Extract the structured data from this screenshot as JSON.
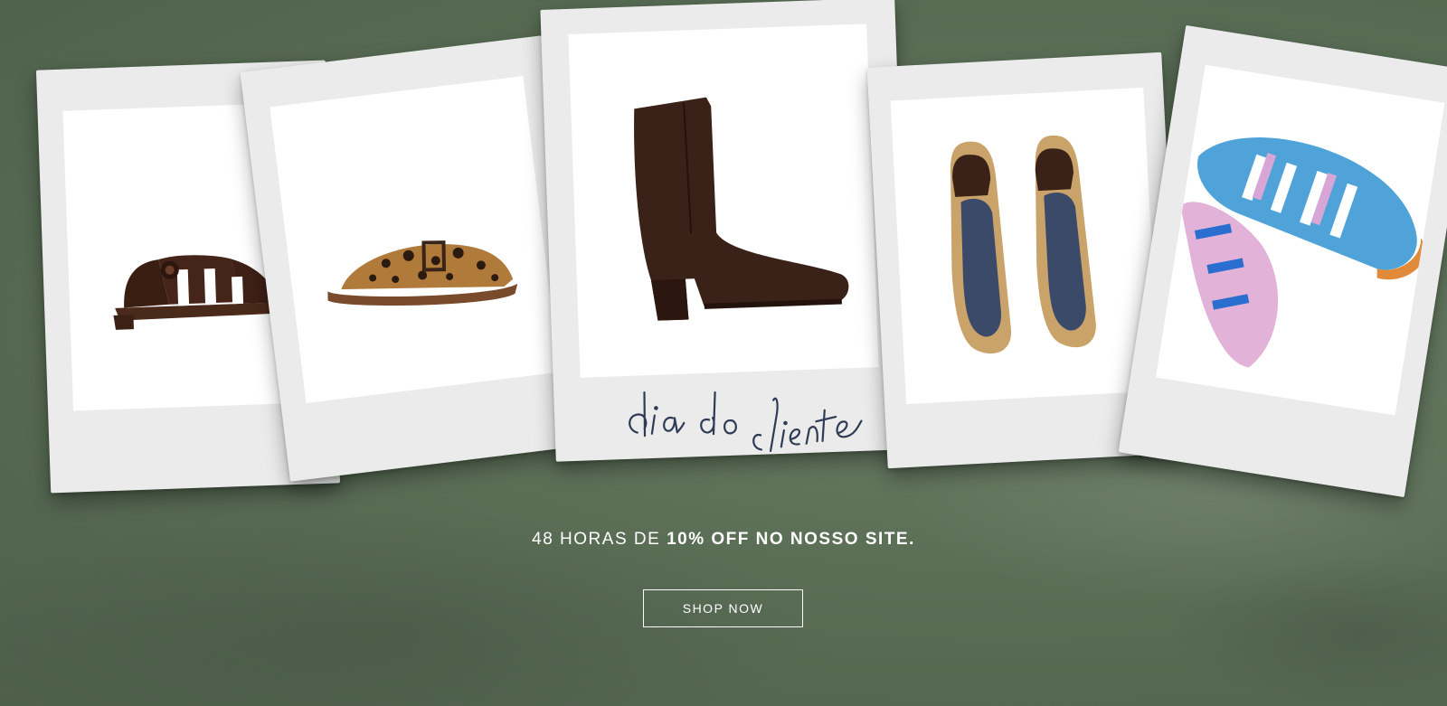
{
  "banner": {
    "script_title": "dia do cliente",
    "promo_prefix": "48 HORAS DE ",
    "promo_highlight": "10% OFF NO NOSSO SITE.",
    "cta_label": "SHOP NOW"
  },
  "products": [
    {
      "name": "dark-brown-fisherman-sandal-photo"
    },
    {
      "name": "leopard-print-mule-photo"
    },
    {
      "name": "brown-leather-ankle-boot-photo"
    },
    {
      "name": "fur-lined-loafers-photo"
    },
    {
      "name": "blue-pink-woven-sandal-photo"
    }
  ],
  "colors": {
    "background": "#5b6f57",
    "polaroid_frame": "#ebebeb",
    "script_ink": "#2f3b55",
    "text": "#ffffff"
  }
}
